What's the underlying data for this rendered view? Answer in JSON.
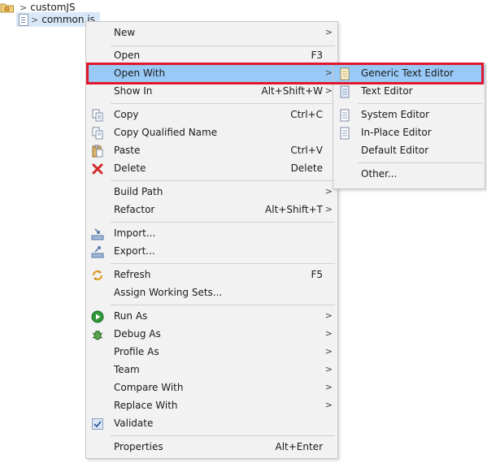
{
  "tree": {
    "folder_label": "customJS",
    "file_label": "common.js",
    "chevron": ">"
  },
  "menu": {
    "items": [
      {
        "label": "New",
        "shortcut": "",
        "sub": true
      },
      {
        "label": "Open",
        "shortcut": "F3",
        "sub": false
      },
      {
        "label": "Open With",
        "shortcut": "",
        "sub": true
      },
      {
        "label": "Show In",
        "shortcut": "Alt+Shift+W",
        "sub": true
      },
      {
        "label": "Copy",
        "shortcut": "Ctrl+C",
        "sub": false
      },
      {
        "label": "Copy Qualified Name",
        "shortcut": "",
        "sub": false
      },
      {
        "label": "Paste",
        "shortcut": "Ctrl+V",
        "sub": false
      },
      {
        "label": "Delete",
        "shortcut": "Delete",
        "sub": false
      },
      {
        "label": "Build Path",
        "shortcut": "",
        "sub": true
      },
      {
        "label": "Refactor",
        "shortcut": "Alt+Shift+T",
        "sub": true
      },
      {
        "label": "Import...",
        "shortcut": "",
        "sub": false
      },
      {
        "label": "Export...",
        "shortcut": "",
        "sub": false
      },
      {
        "label": "Refresh",
        "shortcut": "F5",
        "sub": false
      },
      {
        "label": "Assign Working Sets...",
        "shortcut": "",
        "sub": false
      },
      {
        "label": "Run As",
        "shortcut": "",
        "sub": true
      },
      {
        "label": "Debug As",
        "shortcut": "",
        "sub": true
      },
      {
        "label": "Profile As",
        "shortcut": "",
        "sub": true
      },
      {
        "label": "Team",
        "shortcut": "",
        "sub": true
      },
      {
        "label": "Compare With",
        "shortcut": "",
        "sub": true
      },
      {
        "label": "Replace With",
        "shortcut": "",
        "sub": true
      },
      {
        "label": "Validate",
        "shortcut": "",
        "sub": false
      },
      {
        "label": "Properties",
        "shortcut": "Alt+Enter",
        "sub": false
      }
    ],
    "submenu_arrow": ">"
  },
  "submenu": {
    "items": [
      {
        "label": "Generic Text Editor"
      },
      {
        "label": "Text Editor"
      },
      {
        "label": "System Editor"
      },
      {
        "label": "In-Place Editor"
      },
      {
        "label": "Default Editor"
      },
      {
        "label": "Other..."
      }
    ]
  },
  "colors": {
    "highlight": "#99c9f6",
    "menu_bg": "#f2f2f2",
    "annotation_red": "#e0182d"
  }
}
